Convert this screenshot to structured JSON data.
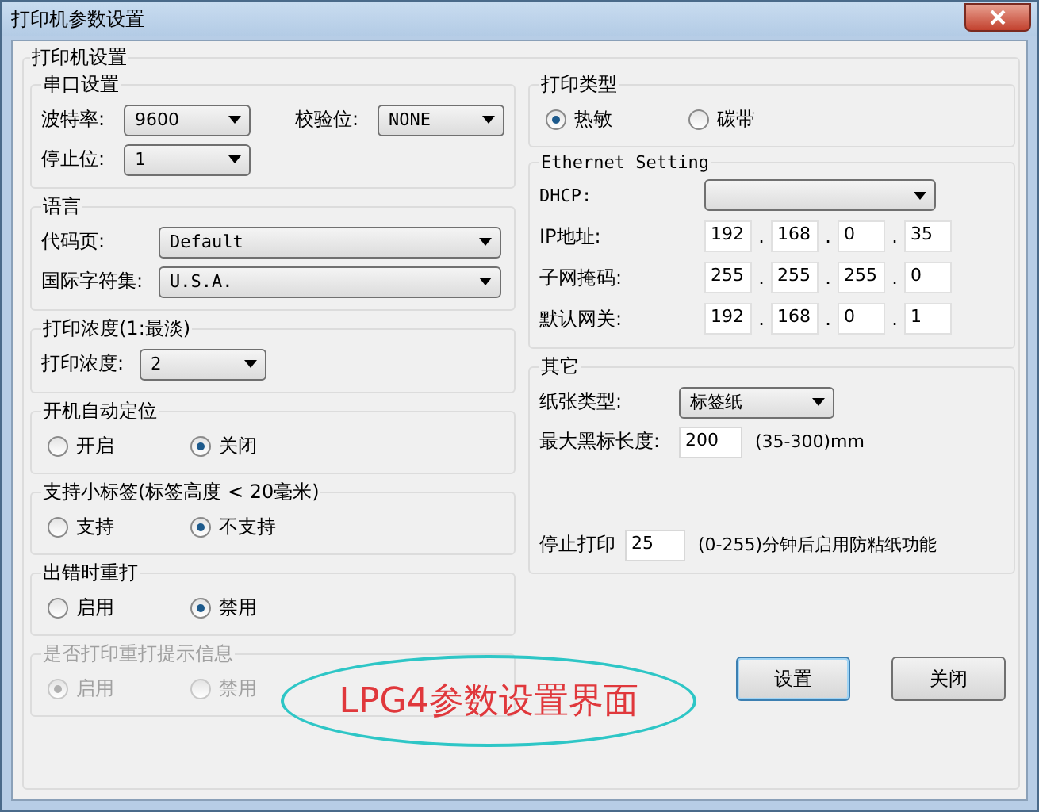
{
  "window": {
    "title": "打印机参数设置"
  },
  "printer_settings": {
    "title": "打印机设置"
  },
  "serial": {
    "title": "串口设置",
    "fields": [
      {
        "label": "波特率:",
        "value": "9600"
      },
      {
        "label": "校验位:",
        "value": "NONE"
      },
      {
        "label": "停止位:",
        "value": "1"
      }
    ]
  },
  "language": {
    "title": "语言",
    "fields": [
      {
        "label": "代码页:",
        "value": "Default"
      },
      {
        "label": "国际字符集:",
        "value": "U.S.A."
      }
    ]
  },
  "density": {
    "title": "打印浓度(1:最淡)",
    "field": {
      "label": "打印浓度:",
      "value": "2"
    }
  },
  "radio_groups": [
    {
      "title": "开机自动定位",
      "disabled": false,
      "options": [
        {
          "label": "开启",
          "selected": false
        },
        {
          "label": "关闭",
          "selected": true
        }
      ]
    },
    {
      "title": "支持小标签(标签高度 < 20毫米)",
      "disabled": false,
      "options": [
        {
          "label": "支持",
          "selected": false
        },
        {
          "label": "不支持",
          "selected": true
        }
      ]
    },
    {
      "title": "出错时重打",
      "disabled": false,
      "options": [
        {
          "label": "启用",
          "selected": false
        },
        {
          "label": "禁用",
          "selected": true
        }
      ]
    },
    {
      "title": "是否打印重打提示信息",
      "disabled": true,
      "options": [
        {
          "label": "启用",
          "selected": true
        },
        {
          "label": "禁用",
          "selected": false
        }
      ]
    }
  ],
  "print_type": {
    "title": "打印类型",
    "options": [
      {
        "label": "热敏",
        "selected": true
      },
      {
        "label": "碳带",
        "selected": false
      }
    ]
  },
  "ethernet": {
    "title": "Ethernet Setting",
    "dhcp_label": "DHCP:",
    "separator": ".",
    "rows": [
      {
        "label": "IP地址:",
        "octets": [
          "192",
          "168",
          "0",
          "35"
        ]
      },
      {
        "label": "子网掩码:",
        "octets": [
          "255",
          "255",
          "255",
          "0"
        ]
      },
      {
        "label": "默认网关:",
        "octets": [
          "192",
          "168",
          "0",
          "1"
        ]
      }
    ]
  },
  "other": {
    "title": "其它",
    "paper_type": {
      "label": "纸张类型:",
      "value": "标签纸"
    },
    "max_mark": {
      "label": "最大黑标长度:",
      "value": "200",
      "hint": "(35-300)mm"
    },
    "stop_print": {
      "label": "停止打印",
      "value": "25",
      "hint": "(0-255)分钟后启用防粘纸功能"
    }
  },
  "buttons": [
    {
      "label": "设置",
      "default": true
    },
    {
      "label": "关闭",
      "default": false
    }
  ],
  "annotation": {
    "text": "LPG4参数设置界面"
  }
}
